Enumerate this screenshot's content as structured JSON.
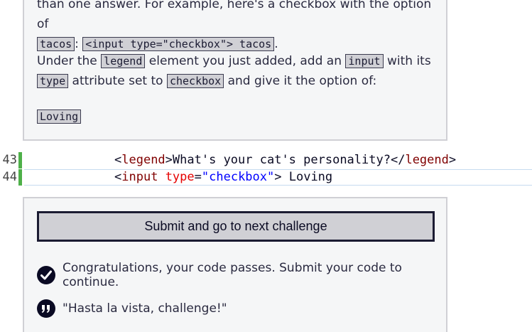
{
  "instructions": {
    "p1_line1": "than one answer. For example, here's a checkbox with the option of",
    "p1_code1": "tacos",
    "p1_sep": ":",
    "p1_code2": "<input type=\"checkbox\"> tacos",
    "p1_end": ".",
    "p2_text1": "Under the",
    "p2_code1": "legend",
    "p2_text2": "element you just added, add an",
    "p2_code2": "input",
    "p2_text3": "with its",
    "p2_code3": "type",
    "p2_text4": "attribute set to",
    "p2_code4": "checkbox",
    "p2_text5": "and give it the option of:",
    "option_code": "Loving"
  },
  "editor": {
    "lines": [
      {
        "number": "43",
        "open_tag": "legend",
        "text": "What's your cat's personality?",
        "close_tag": "legend"
      },
      {
        "number": "44",
        "tag": "input",
        "attr": "type",
        "value": "\"checkbox\"",
        "text": " Loving"
      }
    ]
  },
  "result": {
    "submit_label": "Submit and go to next challenge",
    "success_message": "Congratulations, your code passes. Submit your code to continue.",
    "quote": "\"Hasta la vista, challenge!\""
  },
  "colors": {
    "panel_bg": "#f5f6f7",
    "code_bg": "#d0d0d5",
    "pass_bar": "#4eb049",
    "icon_dark": "#0a0a23"
  },
  "icons": [
    "checkmark-circle-icon",
    "quote-icon"
  ]
}
